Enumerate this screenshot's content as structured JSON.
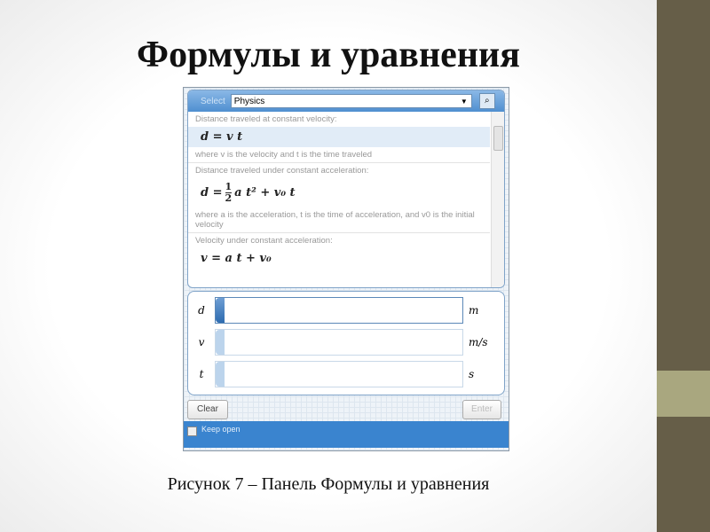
{
  "slide": {
    "title": "Формулы и уравнения",
    "caption": "Рисунок 7 – Панель Формулы и уравнения"
  },
  "colors": {
    "sidebar": "#665e48",
    "sidebar_band": "#a9a77f",
    "panel_accent": "#3a84cf"
  },
  "panel": {
    "select_label": "Select",
    "select_value": "Physics",
    "search_icon": "search-icon",
    "formulas": [
      {
        "title": "Distance traveled at constant velocity:",
        "equation": "d = v t",
        "note": "where v is the velocity and t is the time traveled"
      },
      {
        "title": "Distance traveled under constant acceleration:",
        "eq_lhs": "d =",
        "frac_num": "1",
        "frac_den": "2",
        "eq_rhs": "a t² + v₀ t",
        "note": "where a is the acceleration, t is the time of acceleration, and v0 is the initial velocity"
      },
      {
        "title": "Velocity under constant acceleration:",
        "equation": "v = a t + v₀"
      }
    ],
    "variables": [
      {
        "name": "d",
        "value": "",
        "unit": "m"
      },
      {
        "name": "v",
        "value": "",
        "unit": "m/s"
      },
      {
        "name": "t",
        "value": "",
        "unit": "s"
      }
    ],
    "clear_label": "Clear",
    "enter_label": "Enter",
    "keep_open_label": "Keep open",
    "keep_open_checked": false
  }
}
